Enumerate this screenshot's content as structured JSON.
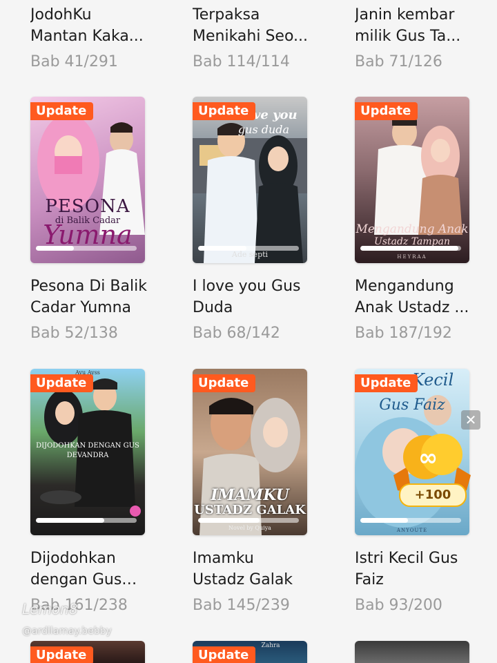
{
  "row0": [
    {
      "title": "JodohKu Mantan Kaka...",
      "chapter": "Bab 41/291"
    },
    {
      "title": "Terpaksa Menikahi Seo...",
      "chapter": "Bab 114/114"
    },
    {
      "title": "Janin kembar milik Gus Ta...",
      "chapter": "Bab 71/126"
    }
  ],
  "row1": [
    {
      "badge": "Update",
      "title": "Pesona Di Balik Cadar Yumna",
      "chapter": "Bab 52/138",
      "progress": 0.38,
      "cover_line1": "PESONA",
      "cover_line2": "di Balik Cadar",
      "cover_line3": "Yumna"
    },
    {
      "badge": "Update",
      "title": "I love you Gus Duda",
      "chapter": "Bab 68/142",
      "progress": 0.48,
      "cover_line1": "I love you",
      "cover_line2": "gus duda",
      "cover_line3": "Ade septi"
    },
    {
      "badge": "Update",
      "title": "Mengandung Anak Ustadz ...",
      "chapter": "Bab 187/192",
      "progress": 0.97,
      "cover_line1": "Mengandung Anak",
      "cover_line2": "Ustadz Tampan",
      "cover_line3": "HEYRAA"
    }
  ],
  "row2": [
    {
      "badge": "Update",
      "title": "Dijodohkan dengan Gus D...",
      "chapter": "Bab 161/238",
      "progress": 0.68,
      "cover_line1": "Ayu Ayss",
      "cover_line2": "DIJODOHKAN DENGAN GUS",
      "cover_line3": "DEVANDRA"
    },
    {
      "badge": "Update",
      "title": "Imamku Ustadz Galak",
      "chapter": "Bab 145/239",
      "progress": 0.61,
      "cover_line1": "IMAMKU",
      "cover_line2": "USTADZ GALAK",
      "cover_line3": "Novel by Quiya"
    },
    {
      "badge": "Update",
      "title": "Istri Kecil Gus Faiz",
      "chapter": "Bab 93/200",
      "progress": 0.47,
      "cover_line1": "Kecil",
      "cover_line2": "Gus Faiz",
      "cover_line3": "ANYOUTE"
    }
  ],
  "row3": [
    {
      "badge": "Update"
    },
    {
      "badge": "Update",
      "cover_line1": "Zahra"
    },
    {}
  ],
  "reward": {
    "amount": "+100",
    "close_icon": "✕"
  },
  "watermark": {
    "line1": "Lemon8",
    "line2": "@ardilamay.bebby"
  },
  "colors": {
    "badge": "#ff5a1f",
    "background": "#f5f5f5",
    "title": "#1c1c1c",
    "chapter": "#9a9a9a"
  }
}
